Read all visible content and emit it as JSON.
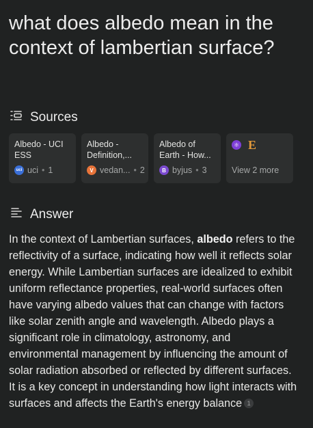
{
  "question": "what does albedo mean in the context of lambertian surface?",
  "sources": {
    "heading": "Sources",
    "cards": [
      {
        "title": "Albedo - UCI ESS",
        "site": "uci",
        "count": "1",
        "favicon": "uci"
      },
      {
        "title": "Albedo - Definition,...",
        "site": "vedan...",
        "count": "2",
        "favicon": "V"
      },
      {
        "title": "Albedo of Earth - How...",
        "site": "byjus",
        "count": "3",
        "favicon": "B"
      }
    ],
    "more_label": "View 2 more"
  },
  "answer": {
    "heading": "Answer",
    "pre": "In the context of Lambertian surfaces, ",
    "term": "albedo",
    "post": " refers to the reflectivity of a surface, indicating how well it reflects solar energy. While Lambertian surfaces are idealized to exhibit uniform reflectance properties, real-world surfaces often have varying albedo values that can change with factors like solar zenith angle and wavelength. Albedo plays a significant role in climatology, astronomy, and environmental management by influencing the amount of solar radiation absorbed or reflected by different surfaces. It is a key concept in understanding how light interacts with surfaces and affects the Earth's energy balance",
    "citation": "1"
  },
  "colors": {
    "background": "#202222",
    "card": "#2d2f2f",
    "text": "#e8e8e6",
    "muted": "#a6a8a8"
  }
}
